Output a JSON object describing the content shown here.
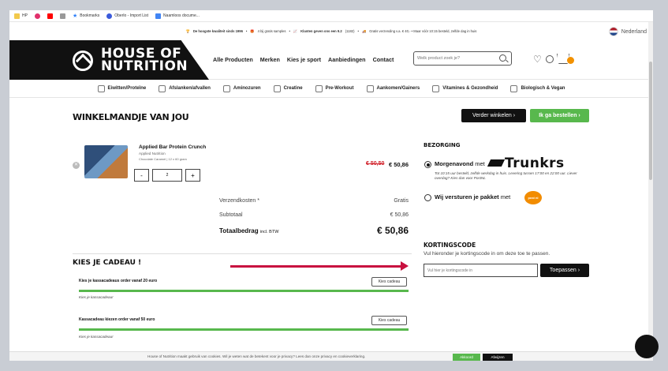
{
  "bookmarks": [
    {
      "label": "HP",
      "color": "#f2c94c"
    },
    {
      "label": "",
      "color": "#e1306c"
    },
    {
      "label": "",
      "color": "#ff0000"
    },
    {
      "label": "",
      "color": "#999999"
    },
    {
      "label": "Bookmarks",
      "color": "#2d7ff9"
    },
    {
      "label": "Oberlo - Import List",
      "color": "#3b5bdb"
    },
    {
      "label": "Naamloos docume...",
      "color": "#4285f4"
    }
  ],
  "topbar": {
    "item1": "De hoogste kwaliteit sinds 1996",
    "item2": "4 bij gratis samples",
    "item3": "Klanten geven ons een 9.2",
    "item3_count": "(1182)",
    "item4": "Gratis verzending v.a. € 40,- • Maar vóór 10:15 besteld, zelfde dag in huis",
    "language": "Nederland"
  },
  "header": {
    "logo_line1": "HOUSE OF",
    "logo_line2": "NUTRITION",
    "nav": [
      "Alle Producten",
      "Merken",
      "Kies je sport",
      "Aanbiedingen",
      "Contact"
    ],
    "search_placeholder": "Welk product zoek je?"
  },
  "categories": [
    "Eiwitten/Proteïne",
    "Afslanken/afvallen",
    "Aminozuren",
    "Creatine",
    "Pre-Workout",
    "Aankomen/Gainers",
    "Vitamines & Gezondheid",
    "Biologisch & Vegan"
  ],
  "cart": {
    "title": "WINKELMANDJE VAN JOU",
    "continue_label": "Verder winkelen ›",
    "checkout_label": "Ik ga bestellen ›",
    "product": {
      "name": "Applied Bar Protein Crunch",
      "brand": "Applied Nutrition",
      "variant": "Chocolate Caramel | 12 x 60 gram",
      "qty": "2",
      "minus": "-",
      "plus": "+",
      "price_old": "€ 50,50",
      "price_new": "€ 50,86"
    },
    "summary": {
      "shipping_label": "Verzendkosten *",
      "shipping_value": "Gratis",
      "subtotal_label": "Subtotaal",
      "subtotal_value": "€ 50,86",
      "total_label": "Totaalbedrag",
      "total_suffix": "incl. BTW",
      "total_value": "€ 50,86"
    }
  },
  "gifts": {
    "title": "KIES JE CADEAU !",
    "rows": [
      {
        "label": "Kies je kassacadeaus order vanaf 20 euro",
        "button": "Kies cadeau",
        "sub": "Kies je kassacadeau!"
      },
      {
        "label": "Kassacadeau kiezen order vanaf 50 euro",
        "button": "Kies cadeau",
        "sub": "Kies je kassacadeau!"
      }
    ]
  },
  "delivery": {
    "title": "BEZORGING",
    "option1_bold": "Morgenavond",
    "option1_rest": "met",
    "option1_brand": "Trunkrs",
    "option1_note": "Tot 10:15 uur besteld, zelfde werkdag in huis. Levering tussen 17:00 en 22:00 uur. Liever overdag? Kies dan voor PostNL",
    "option2_bold": "Wij versturen je pakket",
    "option2_rest": "met",
    "option2_brand": "post nl"
  },
  "coupon": {
    "title": "KORTINGSCODE",
    "desc": "Vul hieronder je kortingscode in om deze toe te passen.",
    "placeholder": "Vul hier je kortingscode in",
    "apply_label": "Toepassen ›"
  },
  "cookie": {
    "text": "House of Nutrition maakt gebruik van cookies. Wil je weten wat de betekent voor je privacy? Lees dan onze privacy en cookieverklaring.",
    "accept": "Akkoord",
    "decline": "Afwijzen"
  },
  "colors": {
    "accent_green": "#58b84d",
    "arrow_red": "#c8103f",
    "price_red": "#d2252e",
    "postnl_orange": "#f28c00"
  }
}
